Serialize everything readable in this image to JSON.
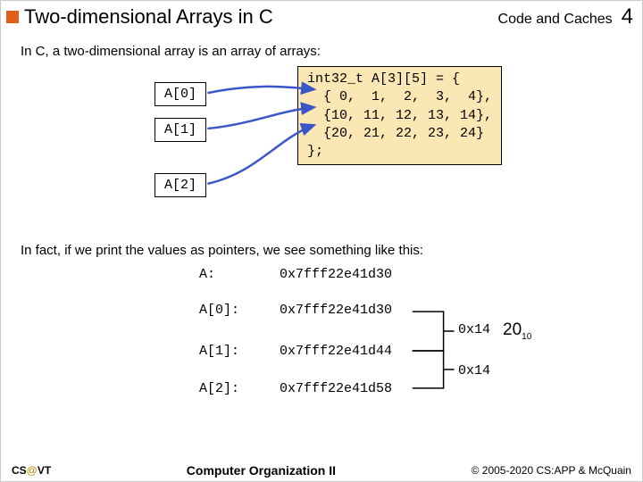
{
  "header": {
    "title": "Two-dimensional Arrays in C",
    "section": "Code and Caches",
    "slide_number": "4"
  },
  "intro1": "In C, a two-dimensional array is an array of arrays:",
  "labels": {
    "a0": "A[0]",
    "a1": "A[1]",
    "a2": "A[2]"
  },
  "code": "int32_t A[3][5] = {\n  { 0,  1,  2,  3,  4},\n  {10, 11, 12, 13, 14},\n  {20, 21, 22, 23, 24}\n};",
  "intro2": "In fact, if we print the values as pointers, we see something like this:",
  "pointers": {
    "A_label": "A:",
    "A_val": "0x7fff22e41d30",
    "A0_label": "A[0]:",
    "A0_val": "0x7fff22e41d30",
    "A1_label": "A[1]:",
    "A1_val": "0x7fff22e41d44",
    "A2_label": "A[2]:",
    "A2_val": "0x7fff22e41d58",
    "diff1": "0x14",
    "diff1_dec": "20",
    "diff1_base": "10",
    "diff2": "0x14"
  },
  "footer": {
    "left_a": "CS",
    "left_at": "@",
    "left_b": "VT",
    "center": "Computer Organization II",
    "right": "© 2005-2020 CS:APP & McQuain"
  }
}
